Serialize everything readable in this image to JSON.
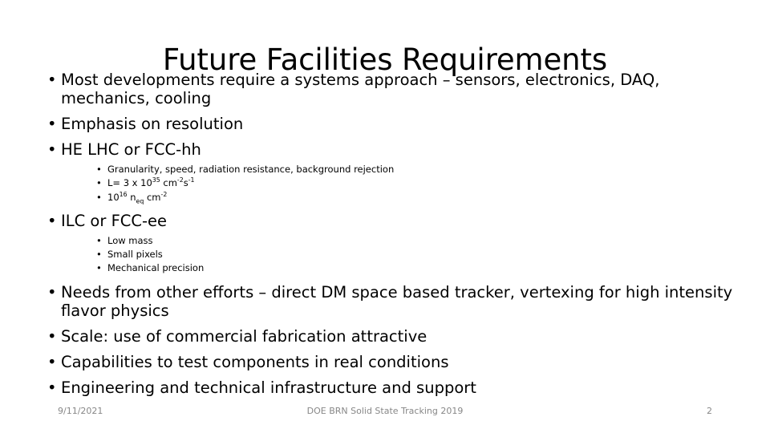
{
  "slide": {
    "title": "Future Facilities Requirements",
    "bullet_glyph": "•",
    "text_color": "#000000",
    "footer_color": "#878787",
    "background": "#ffffff"
  },
  "content": {
    "b1": "Most developments require a systems approach – sensors, electronics, DAQ, mechanics, cooling",
    "b2": "Emphasis on resolution",
    "b3": "HE LHC or FCC-hh",
    "b3_sub": [
      "Granularity, speed, radiation resistance, background rejection",
      "L= 3 x 10^35 cm^-2 s^-1",
      "10^16 n_eq cm^-2"
    ],
    "b4": "ILC or FCC-ee",
    "b4_sub": [
      "Low mass",
      "Small pixels",
      "Mechanical precision"
    ],
    "b5": "Needs from other efforts – direct DM space based tracker, vertexing for high intensity flavor physics",
    "b6": "Scale: use of commercial fabrication attractive",
    "b7": "Capabilities to test components in real conditions",
    "b8": "Engineering and technical infrastructure and support",
    "formulas": {
      "lum_prefix": "L= 3 x 10",
      "lum_exp": "35",
      "lum_unit_base": " cm",
      "lum_unit_exp1": "-2",
      "lum_unit_mid": "s",
      "lum_unit_exp2": "-1",
      "flu_base": "10",
      "flu_exp": "16",
      "flu_particle": " n",
      "flu_particle_sub": "eq",
      "flu_unit_base": " cm",
      "flu_unit_exp": "-2"
    }
  },
  "footer": {
    "date": "9/11/2021",
    "center": "DOE BRN Solid State Tracking  2019",
    "page": "2"
  }
}
